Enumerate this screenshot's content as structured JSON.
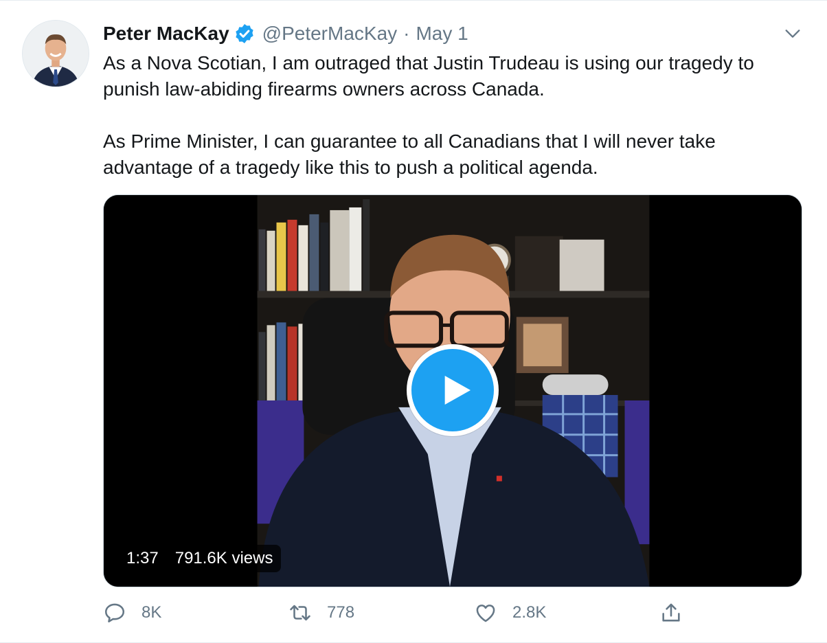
{
  "tweet": {
    "author_name": "Peter MacKay",
    "handle": "@PeterMacKay",
    "separator": "·",
    "date": "May 1",
    "paragraphs": [
      "As a Nova Scotian, I am outraged that Justin Trudeau is using our tragedy to punish law-abiding firearms owners across Canada.",
      "As Prime Minister, I can guarantee to all Canadians that I will never take advantage of a tragedy like this to push a political agenda."
    ]
  },
  "video": {
    "duration": "1:37",
    "views": "791.6K views"
  },
  "actions": {
    "reply_count": "8K",
    "retweet_count": "778",
    "like_count": "2.8K"
  },
  "colors": {
    "accent": "#1da1f2",
    "text": "#14171a",
    "muted": "#657786"
  },
  "icons": {
    "verified": "verified-badge-icon",
    "caret": "chevron-down-icon",
    "play": "play-icon",
    "reply": "reply-icon",
    "retweet": "retweet-icon",
    "like": "heart-icon",
    "share": "share-icon"
  }
}
